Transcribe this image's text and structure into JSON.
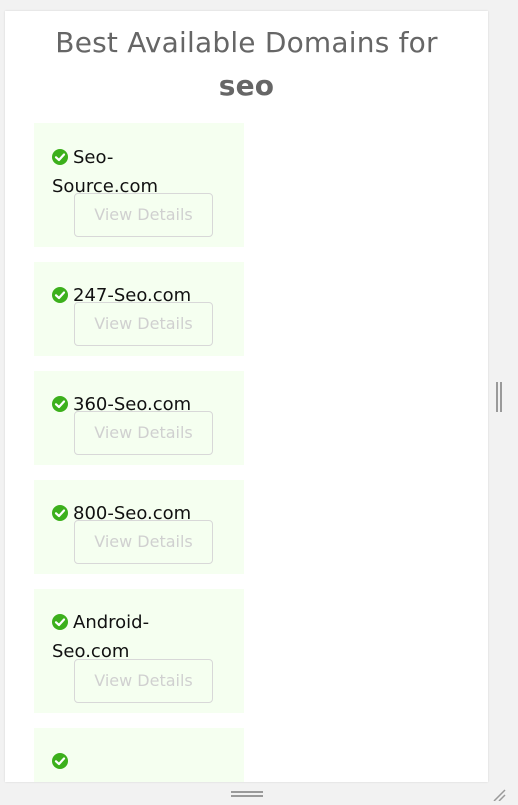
{
  "header": {
    "title_prefix": "Best Available Domains for",
    "keyword": "seo"
  },
  "domains": [
    {
      "name_line1": "Seo-",
      "name_line2": "Source.com",
      "button_label": "View Details"
    },
    {
      "name_line1": "247-Seo.com",
      "button_label": "View Details"
    },
    {
      "name_line1": "360-Seo.com",
      "button_label": "View Details"
    },
    {
      "name_line1": "800-Seo.com",
      "button_label": "View Details"
    },
    {
      "name_line1": "Android-",
      "name_line2": "Seo.com",
      "button_label": "View Details"
    },
    {
      "name_line1": ""
    }
  ],
  "icons": {
    "domain_status": "check-circle-icon",
    "side_resize": "vertical-resize-handle-icon",
    "bottom_resize": "horizontal-resize-handle-icon",
    "corner_resize": "resize-grip-icon"
  },
  "colors": {
    "card_background": "#f5fff0",
    "check_green": "#3cb01c",
    "title_gray": "#666666"
  }
}
